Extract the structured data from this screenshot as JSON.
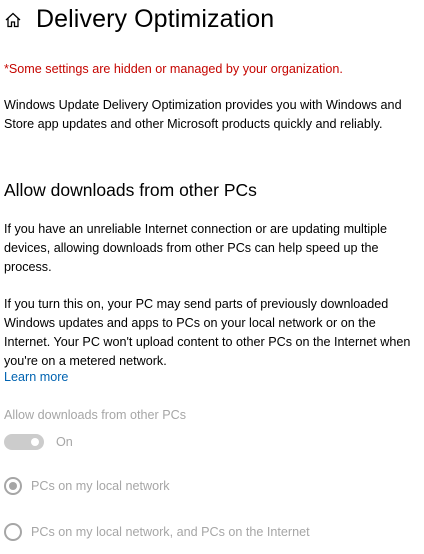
{
  "header": {
    "icon": "home-icon",
    "title": "Delivery Optimization"
  },
  "warning": "*Some settings are hidden or managed by your organization.",
  "intro": "Windows Update Delivery Optimization provides you with Windows and Store app updates and other Microsoft products quickly and reliably.",
  "section": {
    "heading": "Allow downloads from other PCs",
    "para_unreliable": "If you have an unreliable Internet connection or are updating multiple devices, allowing downloads from other PCs can help speed up the process.",
    "para_turnon": "If you turn this on, your PC may send parts of previously downloaded Windows updates and apps to PCs on your local network or on the Internet. Your PC won't upload content to other PCs on the Internet when you're on a metered network.",
    "learn_more": "Learn more"
  },
  "setting": {
    "label": "Allow downloads from other PCs",
    "toggle_state": "On",
    "toggle_on": true,
    "disabled": true
  },
  "options": [
    {
      "label": "PCs on my local network",
      "selected": true
    },
    {
      "label": "PCs on my local network, and PCs on the Internet",
      "selected": false
    }
  ],
  "colors": {
    "warning": "#c50500",
    "link": "#0063b1",
    "disabled": "#a6a6a6"
  }
}
